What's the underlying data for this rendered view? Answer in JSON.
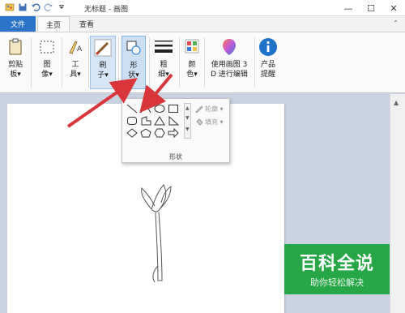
{
  "window": {
    "title": "无标题 - 画图",
    "minimize": "—",
    "maximize": "☐",
    "close": "✕"
  },
  "tabs": [
    {
      "label": "文件"
    },
    {
      "label": "主页"
    },
    {
      "label": "查看"
    }
  ],
  "ribbon": {
    "clipboard": "剪贴\n板▾",
    "image": "图\n像▾",
    "tools": "工\n具▾",
    "brushes": "刷\n子▾",
    "shapes": "形\n状▾",
    "size": "粗\n细▾",
    "colors": "颜\n色▾",
    "paint3d": "使用画图 3\nD 进行编辑",
    "product_alert": "产品\n提醒"
  },
  "shapes_popup": {
    "outline": "轮廓 ▾",
    "fill": "填充 ▾",
    "group_label": "形状"
  },
  "watermark": {
    "title": "百科全说",
    "subtitle": "助你轻松解决"
  },
  "colors": {
    "file_tab": "#2b74c7",
    "arrow": "#d8363a",
    "watermark": "#26a646"
  }
}
